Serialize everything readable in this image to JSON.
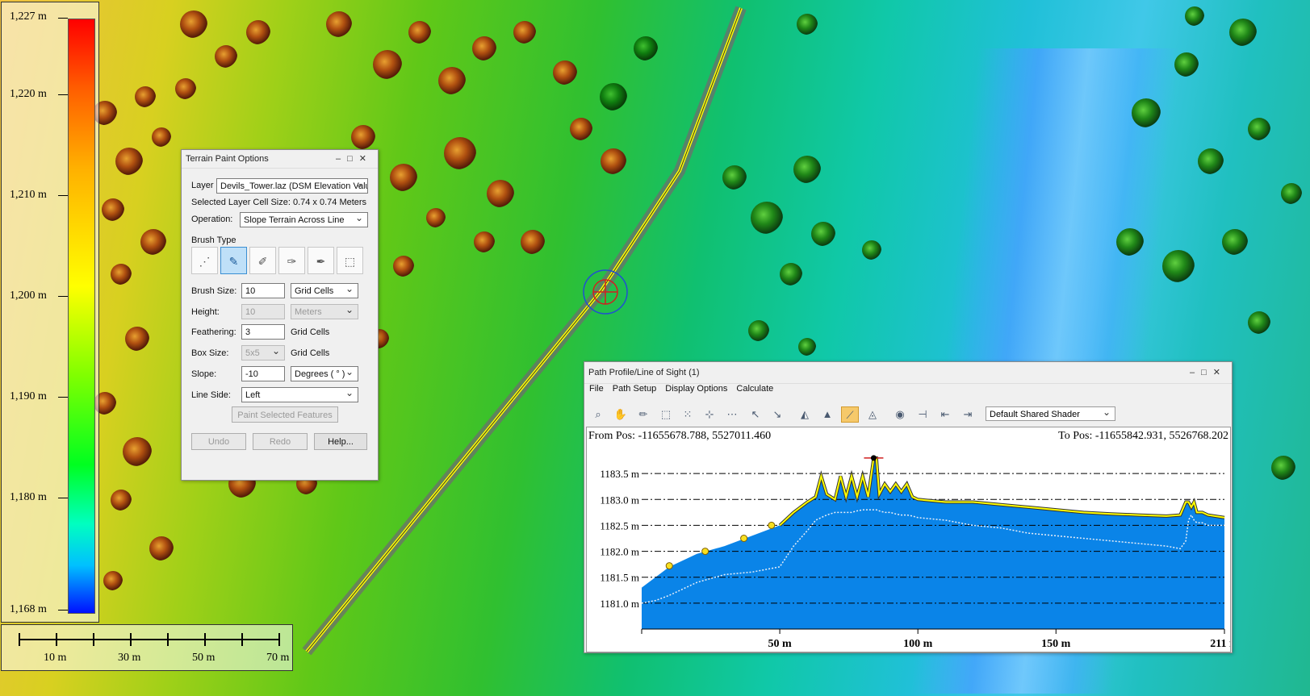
{
  "legend": {
    "labels": [
      "1,227 m",
      "1,220 m",
      "1,210 m",
      "1,200 m",
      "1,190 m",
      "1,180 m",
      "1,168 m"
    ]
  },
  "scale_bar": {
    "labels": [
      "10 m",
      "30 m",
      "50 m",
      "70 m"
    ]
  },
  "terrain_paint": {
    "title": "Terrain Paint Options",
    "layer_label": "Layer",
    "layer_value": "Devils_Tower.laz (DSM Elevation Valu",
    "cell_size_text": "Selected Layer Cell Size: 0.74 x 0.74 Meters",
    "operation_label": "Operation:",
    "operation_value": "Slope Terrain Across Line",
    "brush_type_label": "Brush Type",
    "brush_icons": [
      "dotted-line-brush-icon",
      "line-brush-icon",
      "smooth-brush-icon",
      "stamp-brush-icon",
      "flatten-brush-icon",
      "select-area-brush-icon"
    ],
    "brush_size_label": "Brush Size:",
    "brush_size_value": "10",
    "brush_size_unit": "Grid Cells",
    "height_label": "Height:",
    "height_value": "10",
    "height_unit": "Meters",
    "feathering_label": "Feathering:",
    "feathering_value": "3",
    "feathering_unit": "Grid Cells",
    "box_size_label": "Box Size:",
    "box_size_value": "5x5",
    "box_size_unit": "Grid Cells",
    "slope_label": "Slope:",
    "slope_value": "-10",
    "slope_unit": "Degrees ( ° )",
    "line_side_label": "Line Side:",
    "line_side_value": "Left",
    "paint_button": "Paint Selected Features",
    "undo_button": "Undo",
    "redo_button": "Redo",
    "help_button": "Help..."
  },
  "profile": {
    "title": "Path Profile/Line of Sight (1)",
    "menu": [
      "File",
      "Path Setup",
      "Display Options",
      "Calculate"
    ],
    "toolbar_icons": [
      "zoom-icon",
      "pan-hand-icon",
      "eraser-icon",
      "select-box-icon",
      "select-points-icon",
      "grid-icon",
      "grid-alt-icon",
      "pointer-icon",
      "line-pointer-icon",
      "terrain-edit-icon",
      "terrain-fill-icon",
      "slope-line-icon",
      "terrain-view-icon",
      "line-of-sight-icon",
      "profile-cut-icon",
      "profile-left-icon",
      "profile-right-icon"
    ],
    "shader_value": "Default Shared Shader",
    "from_pos": "From Pos: -11655678.788, 5527011.460",
    "to_pos": "To Pos: -11655842.931, 5526768.202"
  },
  "colors": {
    "profile_fill": "#0a84e8",
    "profile_line": "#ffff00",
    "accent_on": "#f6c96a"
  },
  "chart_data": {
    "type": "area",
    "y_ticks": [
      "1183.5 m",
      "1183.0 m",
      "1182.5 m",
      "1182.0 m",
      "1181.5 m",
      "1181.0 m"
    ],
    "y_values": [
      1183.5,
      1183.0,
      1182.5,
      1182.0,
      1181.5,
      1181.0
    ],
    "x_ticks": [
      "50 m",
      "100 m",
      "150 m",
      "211 m"
    ],
    "x_values": [
      50,
      100,
      150,
      211
    ],
    "xlim": [
      0,
      211
    ],
    "ylim": [
      1180.5,
      1184.0
    ],
    "grid": true,
    "x": [
      0,
      5,
      10,
      20,
      30,
      40,
      50,
      55,
      60,
      63,
      65,
      67,
      70,
      72,
      74,
      76,
      78,
      80,
      82,
      84,
      85,
      86,
      88,
      90,
      92,
      94,
      96,
      98,
      100,
      110,
      120,
      130,
      140,
      150,
      160,
      170,
      180,
      190,
      195,
      197,
      198,
      199,
      200,
      201,
      203,
      205,
      211
    ],
    "surface": [
      1181.3,
      1181.5,
      1181.7,
      1181.95,
      1182.1,
      1182.3,
      1182.5,
      1182.75,
      1182.95,
      1183.05,
      1183.45,
      1183.1,
      1183.0,
      1183.45,
      1183.05,
      1183.45,
      1183.05,
      1183.45,
      1183.05,
      1183.8,
      1183.8,
      1183.1,
      1183.3,
      1183.15,
      1183.3,
      1183.15,
      1183.3,
      1183.05,
      1183.0,
      1182.95,
      1182.95,
      1182.9,
      1182.85,
      1182.8,
      1182.75,
      1182.72,
      1182.7,
      1182.68,
      1182.7,
      1182.95,
      1182.95,
      1182.85,
      1182.95,
      1182.75,
      1182.75,
      1182.7,
      1182.65
    ],
    "ground": [
      1181.0,
      1181.05,
      1181.15,
      1181.4,
      1181.55,
      1181.6,
      1181.7,
      1182.1,
      1182.4,
      1182.6,
      1182.65,
      1182.7,
      1182.75,
      1182.75,
      1182.75,
      1182.75,
      1182.78,
      1182.8,
      1182.8,
      1182.8,
      1182.8,
      1182.78,
      1182.75,
      1182.75,
      1182.72,
      1182.7,
      1182.7,
      1182.68,
      1182.65,
      1182.6,
      1182.5,
      1182.45,
      1182.35,
      1182.3,
      1182.25,
      1182.2,
      1182.15,
      1182.1,
      1182.05,
      1182.2,
      1182.6,
      1182.7,
      1182.6,
      1182.55,
      1182.55,
      1182.5,
      1182.5
    ],
    "markers": [
      {
        "x": 10,
        "y": 1181.72
      },
      {
        "x": 23,
        "y": 1182.0
      },
      {
        "x": 37,
        "y": 1182.25
      },
      {
        "x": 47,
        "y": 1182.5
      },
      {
        "x": 84,
        "y": 1183.8
      }
    ]
  }
}
